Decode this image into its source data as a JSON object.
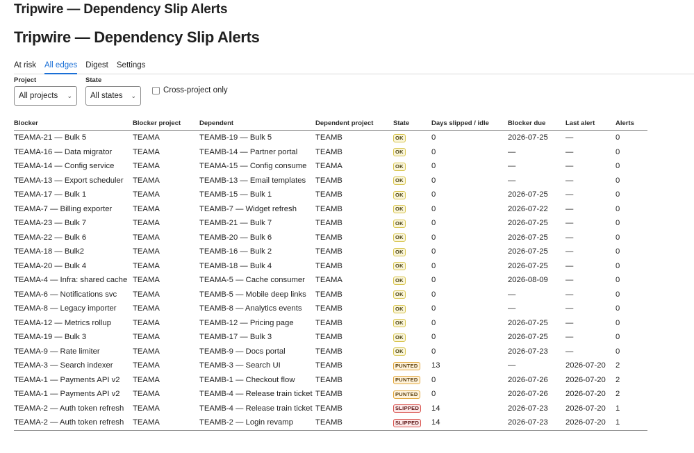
{
  "app": {
    "title": "Tripwire — Dependency Slip Alerts"
  },
  "page": {
    "title": "Tripwire — Dependency Slip Alerts"
  },
  "tabs": [
    {
      "label": "At risk",
      "active": false
    },
    {
      "label": "All edges",
      "active": true
    },
    {
      "label": "Digest",
      "active": false
    },
    {
      "label": "Settings",
      "active": false
    }
  ],
  "filters": {
    "project": {
      "label": "Project",
      "value": "All projects"
    },
    "state": {
      "label": "State",
      "value": "All states"
    },
    "cross_project": {
      "label": "Cross-project only",
      "checked": false
    }
  },
  "colors": {
    "accent": "#1a6fd6",
    "ok": "#d8c550",
    "punted": "#e1a63a",
    "slipped": "#d9534f"
  },
  "table": {
    "headers": [
      "Blocker",
      "Blocker project",
      "Dependent",
      "Dependent project",
      "State",
      "Days slipped / idle",
      "Blocker due",
      "Last alert",
      "Alerts"
    ],
    "rows": [
      {
        "blocker": "TEAMA-21 — Bulk 5",
        "blocker_project": "TEAMA",
        "dependent": "TEAMB-19 — Bulk 5",
        "dependent_project": "TEAMB",
        "state": "OK",
        "days": "0",
        "due": "2026-07-25",
        "last_alert": "—",
        "alerts": "0"
      },
      {
        "blocker": "TEAMA-16 — Data migrator",
        "blocker_project": "TEAMA",
        "dependent": "TEAMB-14 — Partner portal",
        "dependent_project": "TEAMB",
        "state": "OK",
        "days": "0",
        "due": "—",
        "last_alert": "—",
        "alerts": "0"
      },
      {
        "blocker": "TEAMA-14 — Config service",
        "blocker_project": "TEAMA",
        "dependent": "TEAMA-15 — Config consume",
        "dependent_project": "TEAMA",
        "state": "OK",
        "days": "0",
        "due": "—",
        "last_alert": "—",
        "alerts": "0"
      },
      {
        "blocker": "TEAMA-13 — Export scheduler",
        "blocker_project": "TEAMA",
        "dependent": "TEAMB-13 — Email templates",
        "dependent_project": "TEAMB",
        "state": "OK",
        "days": "0",
        "due": "—",
        "last_alert": "—",
        "alerts": "0"
      },
      {
        "blocker": "TEAMA-17 — Bulk 1",
        "blocker_project": "TEAMA",
        "dependent": "TEAMB-15 — Bulk 1",
        "dependent_project": "TEAMB",
        "state": "OK",
        "days": "0",
        "due": "2026-07-25",
        "last_alert": "—",
        "alerts": "0"
      },
      {
        "blocker": "TEAMA-7 — Billing exporter",
        "blocker_project": "TEAMA",
        "dependent": "TEAMB-7 — Widget refresh",
        "dependent_project": "TEAMB",
        "state": "OK",
        "days": "0",
        "due": "2026-07-22",
        "last_alert": "—",
        "alerts": "0"
      },
      {
        "blocker": "TEAMA-23 — Bulk 7",
        "blocker_project": "TEAMA",
        "dependent": "TEAMB-21 — Bulk 7",
        "dependent_project": "TEAMB",
        "state": "OK",
        "days": "0",
        "due": "2026-07-25",
        "last_alert": "—",
        "alerts": "0"
      },
      {
        "blocker": "TEAMA-22 — Bulk 6",
        "blocker_project": "TEAMA",
        "dependent": "TEAMB-20 — Bulk 6",
        "dependent_project": "TEAMB",
        "state": "OK",
        "days": "0",
        "due": "2026-07-25",
        "last_alert": "—",
        "alerts": "0"
      },
      {
        "blocker": "TEAMA-18 — Bulk2",
        "blocker_project": "TEAMA",
        "dependent": "TEAMB-16 — Bulk 2",
        "dependent_project": "TEAMB",
        "state": "OK",
        "days": "0",
        "due": "2026-07-25",
        "last_alert": "—",
        "alerts": "0"
      },
      {
        "blocker": "TEAMA-20 — Bulk 4",
        "blocker_project": "TEAMA",
        "dependent": "TEAMB-18 — Bulk 4",
        "dependent_project": "TEAMB",
        "state": "OK",
        "days": "0",
        "due": "2026-07-25",
        "last_alert": "—",
        "alerts": "0"
      },
      {
        "blocker": "TEAMA-4 — Infra: shared cache",
        "blocker_project": "TEAMA",
        "dependent": "TEAMA-5 — Cache consumer",
        "dependent_project": "TEAMA",
        "state": "OK",
        "days": "0",
        "due": "2026-08-09",
        "last_alert": "—",
        "alerts": "0"
      },
      {
        "blocker": "TEAMA-6 — Notifications svc",
        "blocker_project": "TEAMA",
        "dependent": "TEAMB-5 — Mobile deep links",
        "dependent_project": "TEAMB",
        "state": "OK",
        "days": "0",
        "due": "—",
        "last_alert": "—",
        "alerts": "0"
      },
      {
        "blocker": "TEAMA-8 — Legacy importer",
        "blocker_project": "TEAMA",
        "dependent": "TEAMB-8 — Analytics events",
        "dependent_project": "TEAMB",
        "state": "OK",
        "days": "0",
        "due": "—",
        "last_alert": "—",
        "alerts": "0"
      },
      {
        "blocker": "TEAMA-12 — Metrics rollup",
        "blocker_project": "TEAMA",
        "dependent": "TEAMB-12 — Pricing page",
        "dependent_project": "TEAMB",
        "state": "OK",
        "days": "0",
        "due": "2026-07-25",
        "last_alert": "—",
        "alerts": "0"
      },
      {
        "blocker": "TEAMA-19 — Bulk 3",
        "blocker_project": "TEAMA",
        "dependent": "TEAMB-17 — Bulk 3",
        "dependent_project": "TEAMB",
        "state": "OK",
        "days": "0",
        "due": "2026-07-25",
        "last_alert": "—",
        "alerts": "0"
      },
      {
        "blocker": "TEAMA-9 — Rate limiter",
        "blocker_project": "TEAMA",
        "dependent": "TEAMB-9 — Docs portal",
        "dependent_project": "TEAMB",
        "state": "OK",
        "days": "0",
        "due": "2026-07-23",
        "last_alert": "—",
        "alerts": "0"
      },
      {
        "blocker": "TEAMA-3 — Search indexer",
        "blocker_project": "TEAMA",
        "dependent": "TEAMB-3 — Search UI",
        "dependent_project": "TEAMB",
        "state": "PUNTED",
        "days": "13",
        "due": "—",
        "last_alert": "2026-07-20",
        "alerts": "2"
      },
      {
        "blocker": "TEAMA-1 — Payments API v2",
        "blocker_project": "TEAMA",
        "dependent": "TEAMB-1 — Checkout flow",
        "dependent_project": "TEAMB",
        "state": "PUNTED",
        "days": "0",
        "due": "2026-07-26",
        "last_alert": "2026-07-20",
        "alerts": "2"
      },
      {
        "blocker": "TEAMA-1 — Payments API v2",
        "blocker_project": "TEAMA",
        "dependent": "TEAMB-4 — Release train ticket",
        "dependent_project": "TEAMB",
        "state": "PUNTED",
        "days": "0",
        "due": "2026-07-26",
        "last_alert": "2026-07-20",
        "alerts": "2"
      },
      {
        "blocker": "TEAMA-2 — Auth token refresh",
        "blocker_project": "TEAMA",
        "dependent": "TEAMB-4 — Release train ticket",
        "dependent_project": "TEAMB",
        "state": "SLIPPED",
        "days": "14",
        "due": "2026-07-23",
        "last_alert": "2026-07-20",
        "alerts": "1"
      },
      {
        "blocker": "TEAMA-2 — Auth token refresh",
        "blocker_project": "TEAMA",
        "dependent": "TEAMB-2 — Login revamp",
        "dependent_project": "TEAMB",
        "state": "SLIPPED",
        "days": "14",
        "due": "2026-07-23",
        "last_alert": "2026-07-20",
        "alerts": "1"
      }
    ]
  }
}
